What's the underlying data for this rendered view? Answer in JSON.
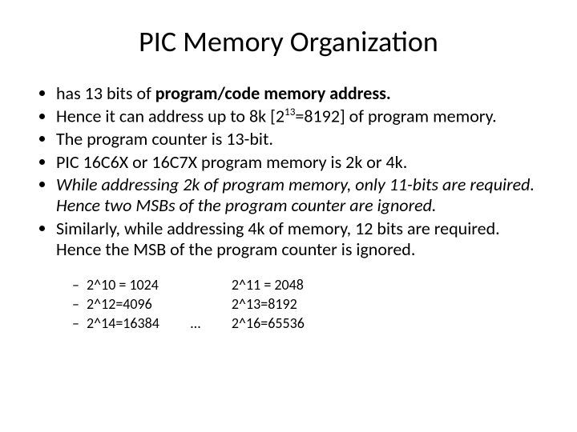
{
  "title": "PIC Memory Organization",
  "bullets": {
    "b1_pre": "has 13 bits of ",
    "b1_bold": "program/code memory address.",
    "b2_pre": "Hence it can address up to 8k [2",
    "b2_sup": "13",
    "b2_post": "=8192] of program memory.",
    "b3": "The program counter is 13-bit.",
    "b4": "PIC 16C6X or 16C7X program memory is 2k or 4k.",
    "b5": "While addressing 2k of program memory, only 11-bits are required. Hence two MSBs of the program counter are ignored.",
    "b6": "Similarly, while addressing 4k of memory, 12 bits are required. Hence the MSB of the program counter is ignored."
  },
  "sub": {
    "l1": "2^10 = 1024",
    "l2": "2^12=4096",
    "l3": "2^14=16384",
    "ell": "…",
    "r1": "2^11 = 2048",
    "r2": "2^13=8192",
    "r3": "2^16=65536"
  }
}
